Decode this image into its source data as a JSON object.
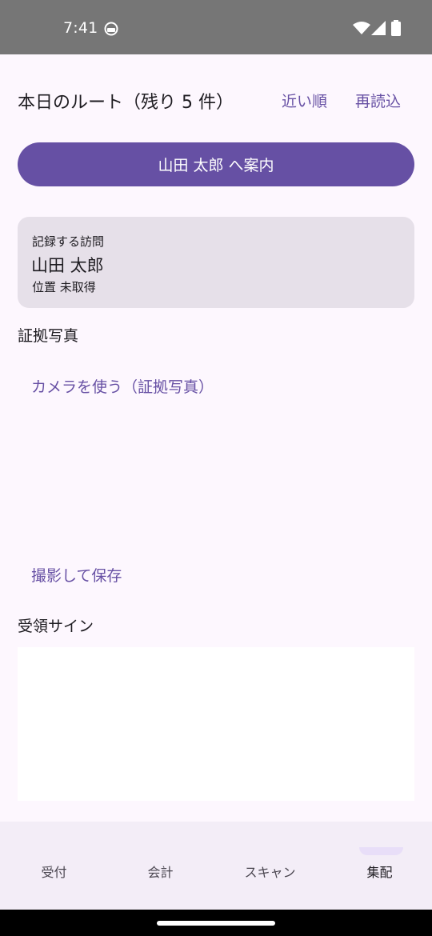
{
  "status_bar": {
    "time": "7:41"
  },
  "header": {
    "title": "本日のルート（残り 5 件）",
    "sort_label": "近い順",
    "reload_label": "再読込"
  },
  "navigate_button": {
    "label": "山田 太郎 へ案内"
  },
  "visit_card": {
    "caption": "記録する訪問",
    "name": "山田 太郎",
    "location": "位置 未取得"
  },
  "photo_section": {
    "label": "証拠写真",
    "camera_label": "カメラを使う（証拠写真）",
    "save_label": "撮影して保存"
  },
  "signature_section": {
    "label": "受領サイン"
  },
  "bottom_nav": {
    "items": [
      {
        "label": "受付"
      },
      {
        "label": "会計"
      },
      {
        "label": "スキャン"
      },
      {
        "label": "集配"
      }
    ],
    "active": "集配"
  },
  "colors": {
    "primary": "#6650a4",
    "card_bg": "#e6e0e9",
    "page_bg": "#fdf7fe",
    "nav_bg": "#f3edf7"
  }
}
